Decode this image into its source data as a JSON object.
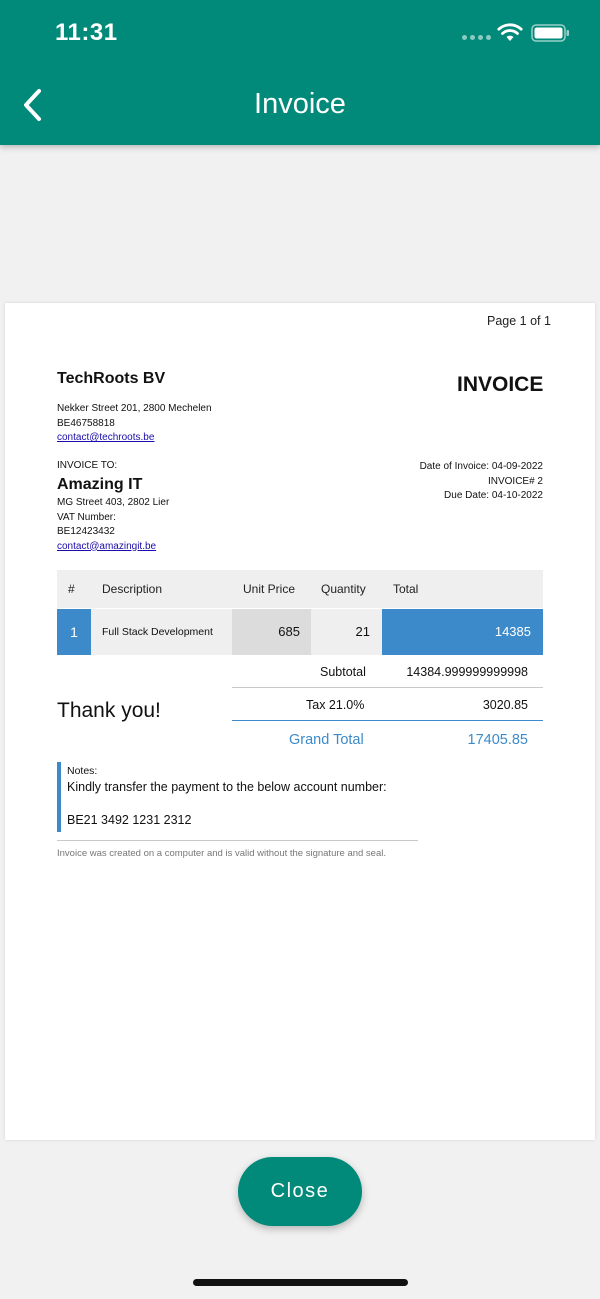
{
  "status_bar": {
    "time": "11:31"
  },
  "header": {
    "title": "Invoice",
    "back_icon": "chevron-left-icon"
  },
  "invoice": {
    "page_label": "Page 1 of 1",
    "doc_title": "INVOICE",
    "company": {
      "name": "TechRoots BV",
      "address": "Nekker Street 201, 2800 Mechelen",
      "vat": "BE46758818",
      "email": "contact@techroots.be"
    },
    "to_label": "INVOICE TO:",
    "client": {
      "name": "Amazing IT",
      "address": "MG Street 403, 2802 Lier",
      "vat_label": "VAT Number:",
      "vat": "BE12423432",
      "email": "contact@amazingit.be"
    },
    "meta": {
      "date": "Date of Invoice: 04-09-2022",
      "number": "INVOICE# 2",
      "due": "Due Date: 04-10-2022"
    },
    "table": {
      "headers": {
        "num": "#",
        "description": "Description",
        "unit_price": "Unit Price",
        "quantity": "Quantity",
        "total": "Total"
      },
      "rows": [
        {
          "num": "1",
          "description": "Full Stack Development",
          "unit_price": "685",
          "quantity": "21",
          "total": "14385"
        }
      ]
    },
    "summary": {
      "subtotal_label": "Subtotal",
      "subtotal": "14384.999999999998",
      "tax_label": "Tax 21.0%",
      "tax": "3020.85",
      "grand_label": "Grand Total",
      "grand": "17405.85"
    },
    "thanks": "Thank you!",
    "notes": {
      "label": "Notes:",
      "text": "Kindly transfer the payment to the below account number:",
      "account": "BE21 3492 1231 2312"
    },
    "footer_note": "Invoice was created on a computer and is valid without the signature and seal."
  },
  "close_button": {
    "label": "Close"
  },
  "colors": {
    "primary": "#018a79",
    "accent_blue": "#3c8ac9",
    "background": "#f1f1f1"
  }
}
